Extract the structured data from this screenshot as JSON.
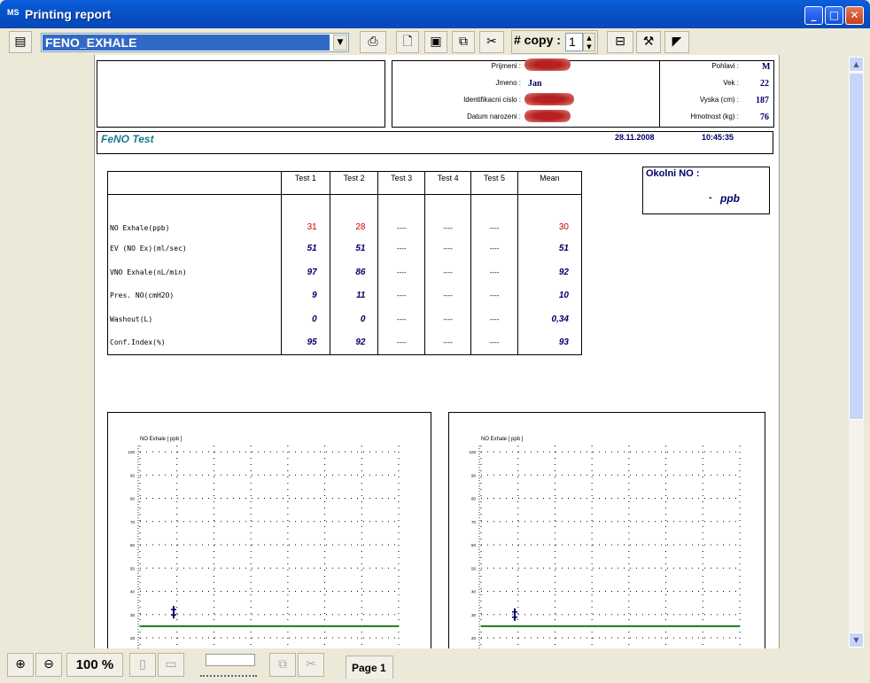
{
  "window": {
    "title": "Printing report",
    "icon": "MS",
    "minimize": "_",
    "maximize": "□",
    "close": "✕"
  },
  "toolbar": {
    "report": "FENO_EXHALE",
    "copy_label": "# copy :",
    "copy_value": "1",
    "icons": [
      "report-icon",
      "print-icon",
      "new-page-icon",
      "save-icon",
      "export-icon",
      "cut-icon",
      "printer-setup-icon",
      "tools-icon",
      "corner-icon"
    ]
  },
  "report": {
    "patient": {
      "surname_label": "Prijmeni :",
      "name_label": "Jmeno :",
      "name": "Jan",
      "id_label": "Identifikacni cislo :",
      "dob_label": "Datum narozeni :",
      "sex_label": "Pohlavi :",
      "sex": "M",
      "age_label": "Vek :",
      "age": "22",
      "height_label": "Vyska (cm) :",
      "height": "187",
      "weight_label": "Hmotnost (kg) :",
      "weight": "76"
    },
    "test": {
      "name": "FeNO Test",
      "date": "28.11.2008",
      "time": "10:45:35"
    },
    "ambient": {
      "label": "Okolni NO :",
      "value": "-",
      "unit": "ppb"
    },
    "table": {
      "headers": [
        "Test 1",
        "Test 2",
        "Test 3",
        "Test 4",
        "Test 5",
        "Mean"
      ],
      "rows": [
        {
          "label": "NO  Exhale(ppb)",
          "values": [
            "31",
            "28",
            "----",
            "----",
            "----",
            "30"
          ]
        },
        {
          "label": "EV (NO Ex)(ml/sec)",
          "values": [
            "51",
            "51",
            "----",
            "----",
            "----",
            "51"
          ]
        },
        {
          "label": "VNO Exhale(nL/min)",
          "values": [
            "97",
            "86",
            "----",
            "----",
            "----",
            "92"
          ]
        },
        {
          "label": "Pres. NO(cmH2O)",
          "values": [
            "9",
            "11",
            "----",
            "----",
            "----",
            "10"
          ]
        },
        {
          "label": "Washout(L)",
          "values": [
            "0",
            "0",
            "----",
            "----",
            "----",
            "0,34"
          ]
        },
        {
          "label": "Conf.Index(%)",
          "values": [
            "95",
            "92",
            "----",
            "----",
            "----",
            "93"
          ]
        }
      ]
    }
  },
  "chart_data": [
    {
      "type": "scatter",
      "ylabel": "NO  Exhale [ ppb ]",
      "yticks": [
        "100",
        "90",
        "80",
        "70",
        "60",
        "50",
        "40",
        "30",
        "20"
      ],
      "ylim": [
        20,
        100
      ],
      "points": [
        {
          "y": 31
        }
      ],
      "reference_line": 25
    },
    {
      "type": "scatter",
      "ylabel": "NO  Exhale [ ppb ]",
      "yticks": [
        "100",
        "90",
        "80",
        "70",
        "60",
        "50",
        "40",
        "30",
        "20"
      ],
      "ylim": [
        20,
        100
      ],
      "points": [
        {
          "y": 30
        }
      ],
      "reference_line": 25
    }
  ],
  "statusbar": {
    "zoom": "100 %",
    "page_label": "Page",
    "page_number": "1"
  },
  "colors": {
    "accent_red": "#cc0000",
    "value_blue": "#000066",
    "teal_title": "#1a7a8a",
    "reference_green": "#1a7a1a"
  }
}
